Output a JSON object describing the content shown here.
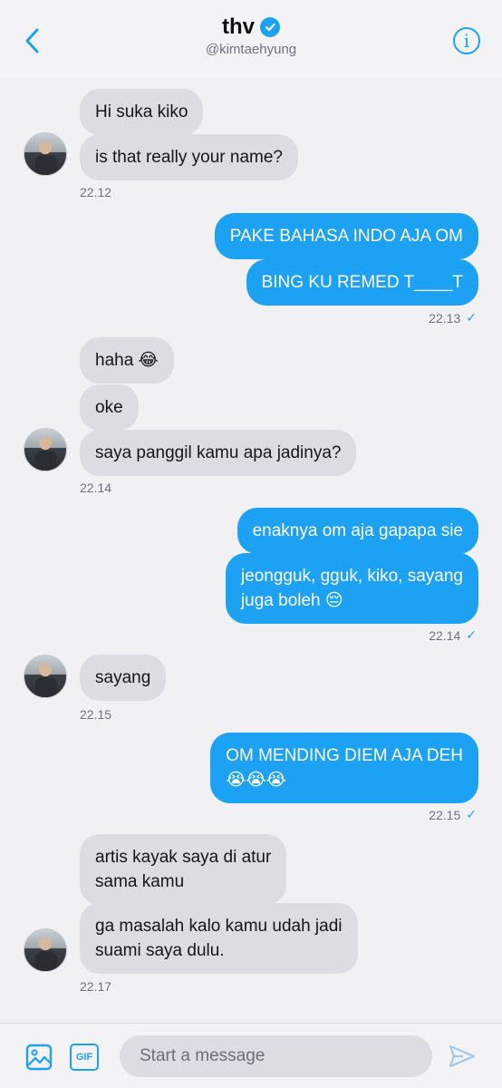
{
  "header": {
    "title": "thv",
    "handle": "@kimtaehyung",
    "info_glyph": "i",
    "back_icon": "chevron-left-icon",
    "verified_icon": "verified-badge-icon"
  },
  "messages": {
    "g1": {
      "m1": "Hi suka kiko",
      "m2": "is that really your name?",
      "time": "22.12"
    },
    "g2": {
      "m1": "PAKE BAHASA INDO AJA OM",
      "m2": "BING KU REMED T____T",
      "time": "22.13"
    },
    "g3": {
      "m1": "haha 😂",
      "m2": "oke",
      "m3": "saya panggil kamu apa jadinya?",
      "time": "22.14"
    },
    "g4": {
      "m1": "enaknya om aja gapapa sie",
      "m2_line1": "jeongguk, gguk, kiko, sayang",
      "m2_line2": "juga boleh 😔",
      "time": "22.14"
    },
    "g5": {
      "m1": "sayang",
      "time": "22.15"
    },
    "g6": {
      "m1_line1": "OM MENDING DIEM AJA DEH",
      "m1_line2": "😭😭😭",
      "time": "22.15"
    },
    "g7": {
      "m1_line1": "artis kayak saya di atur",
      "m1_line2": "sama kamu",
      "m2_line1": "ga masalah kalo kamu udah jadi",
      "m2_line2": "suami saya dulu.",
      "time": "22.17"
    }
  },
  "status": {
    "sent_mark": "✓"
  },
  "composer": {
    "placeholder": "Start a message",
    "gif_label": "GIF"
  },
  "colors": {
    "accent": "#1da1f2",
    "incoming_bubble": "#dcdce2",
    "background": "#f1f1f3"
  }
}
